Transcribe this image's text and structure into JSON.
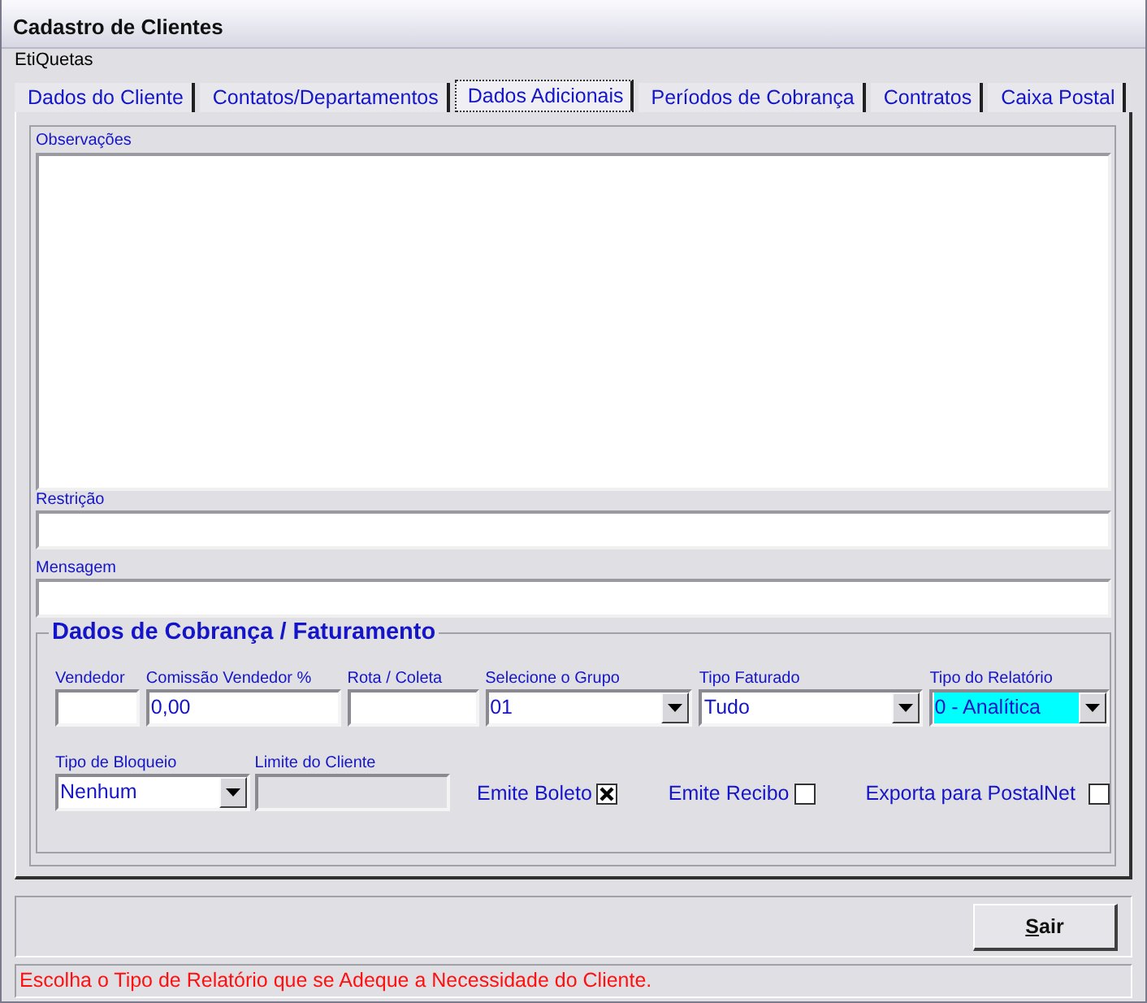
{
  "window": {
    "title": "Cadastro de Clientes"
  },
  "menu": [
    {
      "label": "EtiQuetas"
    }
  ],
  "tabs": [
    {
      "label": "Dados do Cliente",
      "selected": false
    },
    {
      "label": "Contatos/Departamentos",
      "selected": false
    },
    {
      "label": "Dados Adicionais",
      "selected": true
    },
    {
      "label": "Períodos de Cobrança",
      "selected": false
    },
    {
      "label": "Contratos",
      "selected": false
    },
    {
      "label": "Caixa Postal",
      "selected": false
    }
  ],
  "observacoes": {
    "label": "Observações"
  },
  "restricao": {
    "label": "Restrição"
  },
  "mensagem": {
    "label": "Mensagem"
  },
  "billing": {
    "title": "Dados de Cobrança / Faturamento",
    "row_1": [
      {
        "kind": "text",
        "label": "Vendedor",
        "disabled": false
      },
      {
        "kind": "text",
        "label": "Comissão Vendedor %",
        "value": "0,00",
        "disabled": false
      },
      {
        "kind": "text",
        "label": "Rota / Coleta",
        "disabled": false
      },
      {
        "kind": "combo",
        "label": "Selecione o Grupo",
        "value": "01",
        "focused": false
      },
      {
        "kind": "combo",
        "label": "Tipo Faturado",
        "value": "Tudo",
        "focused": false
      },
      {
        "kind": "combo",
        "label": "Tipo do Relatório",
        "value": "0 - Analítica",
        "focused": true
      }
    ],
    "row_2": [
      {
        "kind": "combo",
        "label": "Tipo de Bloqueio",
        "value": "Nenhum",
        "focused": false
      },
      {
        "kind": "text",
        "label": "Limite do Cliente",
        "disabled": true
      }
    ],
    "checks": [
      {
        "label": "Emite Boleto",
        "checked": true
      },
      {
        "label": "Emite Recibo",
        "checked": false
      },
      {
        "label": "Exporta para PostalNet",
        "checked": false
      }
    ]
  },
  "buttons": [
    {
      "label": "Sair",
      "first_letter_underlined": true
    }
  ],
  "status_bar": {
    "text": "Escolha o Tipo de Relatório que se Adeque a Necessidade do Cliente."
  }
}
